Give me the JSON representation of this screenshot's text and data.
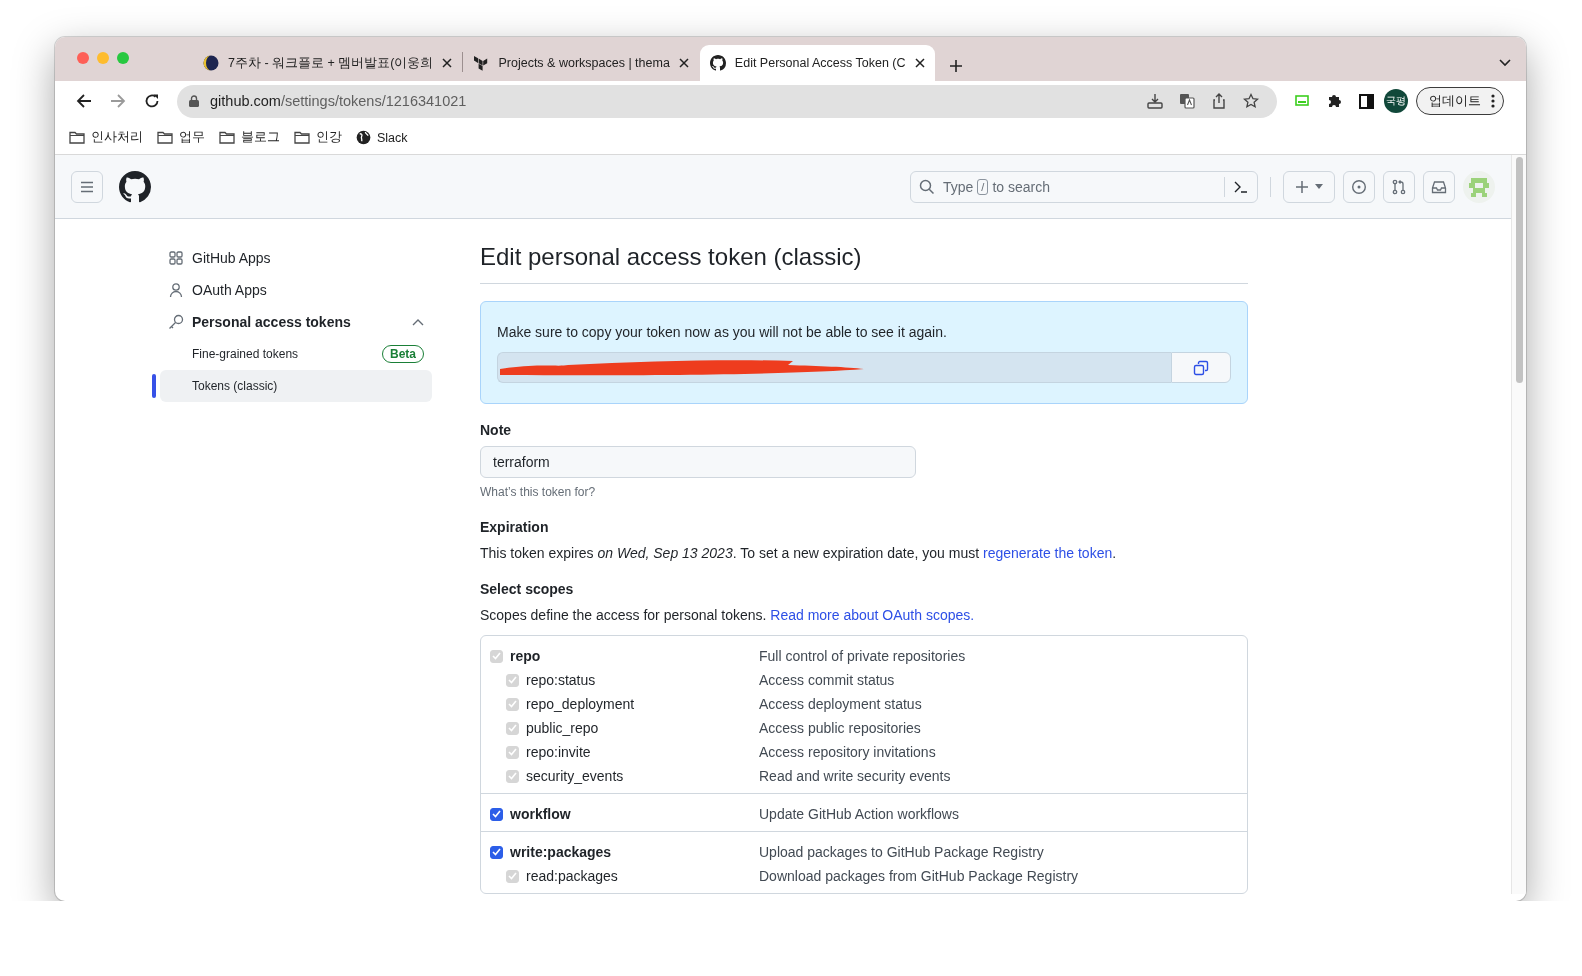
{
  "browser": {
    "tabs": [
      {
        "title": "7주차 - 워크플로 + 멤버발표(이웅희",
        "kind": "moon",
        "selected": false
      },
      {
        "title": "Projects & workspaces | thema",
        "kind": "terraform",
        "selected": false
      },
      {
        "title": "Edit Personal Access Token (C",
        "kind": "github",
        "selected": true
      }
    ],
    "address": {
      "host": "github.com",
      "path": "/settings/tokens/1216341021"
    },
    "profile": "국평",
    "update_button": "업데이트",
    "bookmarks": [
      {
        "label": "인사처리",
        "kind": "folder"
      },
      {
        "label": "업무",
        "kind": "folder"
      },
      {
        "label": "블로그",
        "kind": "folder"
      },
      {
        "label": "인강",
        "kind": "folder"
      },
      {
        "label": "Slack",
        "kind": "site"
      }
    ]
  },
  "header": {
    "search": {
      "before": "Type",
      "key": "/",
      "after": "to search"
    }
  },
  "sidebar": {
    "items": [
      {
        "label": "GitHub Apps",
        "selected": false
      },
      {
        "label": "OAuth Apps",
        "selected": false
      },
      {
        "label": "Personal access tokens",
        "selected": false,
        "expanded": true,
        "children": [
          {
            "label": "Fine-grained tokens",
            "badge": "Beta",
            "selected": false
          },
          {
            "label": "Tokens (classic)",
            "selected": true
          }
        ]
      }
    ]
  },
  "page": {
    "title": "Edit personal access token (classic)",
    "token_notice": "Make sure to copy your token now as you will not be able to see it again.",
    "note": {
      "label": "Note",
      "value": "terraform",
      "hint": "What’s this token for?"
    },
    "expiration": {
      "heading": "Expiration",
      "text": "This token expires *on Wed, Sep 13 2023*. To set a new expiration date, you must ",
      "link": "regenerate the token",
      "after": "."
    },
    "scopes_heading": "Select scopes",
    "scopes_text": "Scopes define the access for personal tokens. ",
    "scopes_link": "Read more about OAuth scopes.",
    "scopes": [
      {
        "name": "repo",
        "description": "Full control of private repositories",
        "checked": true,
        "disabled": true,
        "children": [
          {
            "name": "repo:status",
            "description": "Access commit status",
            "checked": true,
            "disabled": true
          },
          {
            "name": "repo_deployment",
            "description": "Access deployment status",
            "checked": true,
            "disabled": true
          },
          {
            "name": "public_repo",
            "description": "Access public repositories",
            "checked": true,
            "disabled": true
          },
          {
            "name": "repo:invite",
            "description": "Access repository invitations",
            "checked": true,
            "disabled": true
          },
          {
            "name": "security_events",
            "description": "Read and write security events",
            "checked": true,
            "disabled": true
          }
        ]
      },
      {
        "name": "workflow",
        "description": "Update GitHub Action workflows",
        "checked": true,
        "disabled": false
      },
      {
        "name": "write:packages",
        "description": "Upload packages to GitHub Package Registry",
        "checked": true,
        "disabled": false,
        "children": [
          {
            "name": "read:packages",
            "description": "Download packages from GitHub Package Registry",
            "checked": true,
            "disabled": true
          }
        ]
      }
    ]
  }
}
